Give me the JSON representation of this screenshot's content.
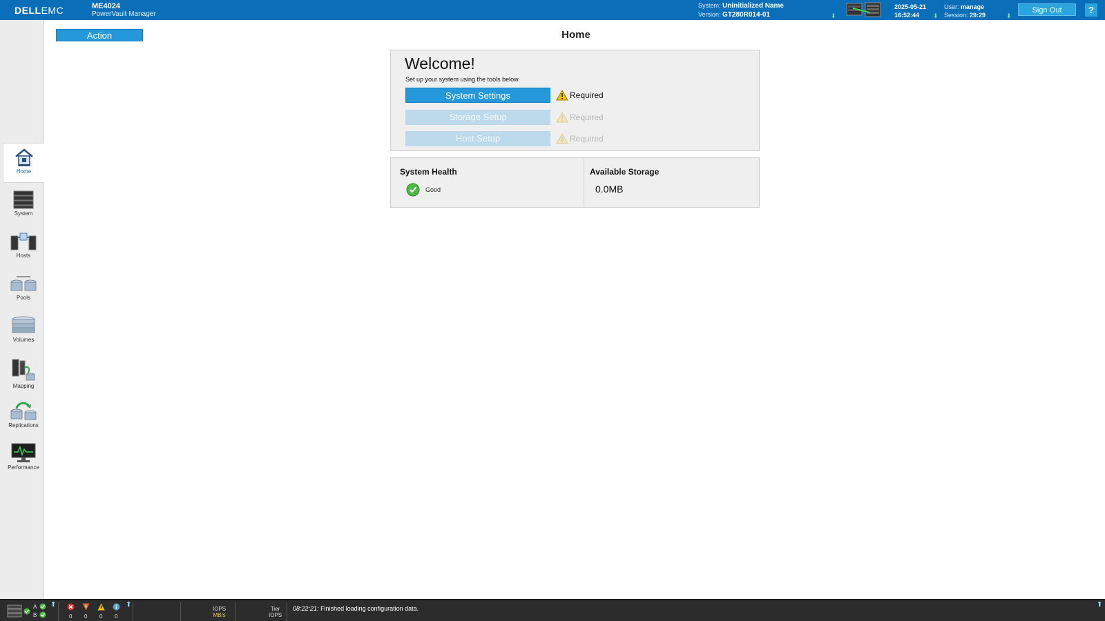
{
  "header": {
    "brand_dell": "DELL",
    "brand_emc": "EMC",
    "model": "ME4024",
    "product_name": "PowerVault Manager",
    "system_label": "System:",
    "system_value": "Uninitialized Name",
    "version_label": "Version:",
    "version_value": "GT280R014-01",
    "date": "2025-05-21",
    "time": "16:52:44",
    "user_label": "User:",
    "user_value": "manage",
    "session_label": "Session:",
    "session_value": "29:29",
    "sign_out_label": "Sign Out",
    "help_label": "?",
    "brand_color": "#0a6fb8"
  },
  "sidebar": {
    "items": [
      {
        "label": "Home",
        "icon": "home-icon",
        "active": true
      },
      {
        "label": "System",
        "icon": "system-icon"
      },
      {
        "label": "Hosts",
        "icon": "hosts-icon"
      },
      {
        "label": "Pools",
        "icon": "pools-icon"
      },
      {
        "label": "Volumes",
        "icon": "volumes-icon"
      },
      {
        "label": "Mapping",
        "icon": "mapping-icon"
      },
      {
        "label": "Replications",
        "icon": "replications-icon"
      },
      {
        "label": "Performance",
        "icon": "performance-icon"
      }
    ]
  },
  "main": {
    "action_label": "Action",
    "page_title": "Home",
    "welcome": {
      "title": "Welcome!",
      "hint": "Set up your system using the tools below.",
      "steps": [
        {
          "label": "System Settings",
          "status": "Required",
          "enabled": true
        },
        {
          "label": "Storage Setup",
          "status": "Required",
          "enabled": false
        },
        {
          "label": "Host Setup",
          "status": "Required",
          "enabled": false
        }
      ]
    },
    "health": {
      "system_health_title": "System Health",
      "system_health_status": "Good",
      "available_storage_title": "Available Storage",
      "available_storage_value": "0.0MB"
    }
  },
  "footer": {
    "controller_a": "A",
    "controller_b": "B",
    "counts": {
      "critical": "0",
      "error": "0",
      "warning": "0",
      "info": "0"
    },
    "iops_label": "IOPS",
    "mbs_label": "MB/s",
    "tier_label": "Tier",
    "tier_iops_label": "IOPS",
    "message_time": "08:22:21:",
    "message_text": "Finished loading configuration data."
  }
}
